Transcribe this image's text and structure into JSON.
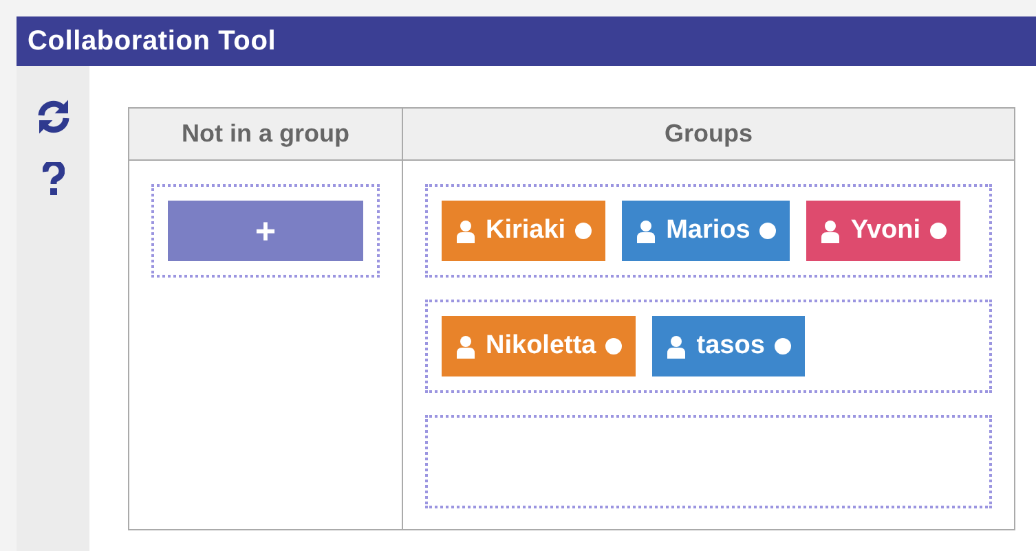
{
  "window": {
    "title": "Collaboration Tool"
  },
  "table": {
    "columns": [
      "Not in a group",
      "Groups"
    ],
    "add_button": {
      "label": "+"
    },
    "groups": [
      {
        "kind": "filled",
        "members": [
          {
            "name": "Kiriaki",
            "color": "#e8832a"
          },
          {
            "name": "Marios",
            "color": "#3d87cc"
          },
          {
            "name": "Yvoni",
            "color": "#de4b6e"
          }
        ]
      },
      {
        "kind": "filled",
        "members": [
          {
            "name": "Nikoletta",
            "color": "#e8832a"
          },
          {
            "name": "tasos",
            "color": "#3d87cc"
          }
        ]
      },
      {
        "kind": "empty"
      }
    ]
  }
}
